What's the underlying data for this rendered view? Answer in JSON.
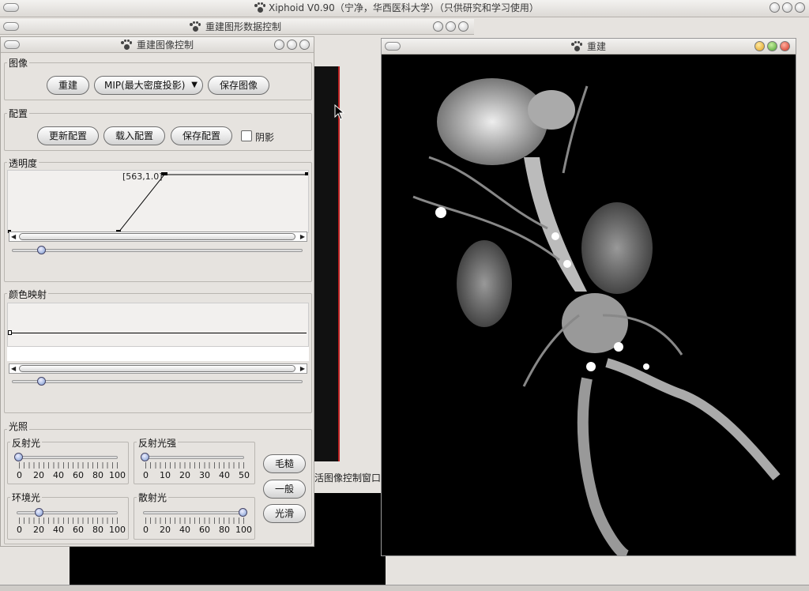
{
  "app": {
    "title": "Xiphoid V0.90（宁净，华西医科大学）（只供研究和学习使用）"
  },
  "back_window": {
    "title": "重建图形数据控制",
    "status_text": "活图像控制窗口"
  },
  "control_window": {
    "title": "重建图像控制",
    "image_group": {
      "label": "图像",
      "rebuild": "重建",
      "mode": "MIP(最大密度投影)",
      "save_image": "保存图像"
    },
    "config_group": {
      "label": "配置",
      "update": "更新配置",
      "load": "载入配置",
      "save": "保存配置",
      "shadow_label": "阴影",
      "shadow_checked": false
    },
    "opacity_group": {
      "label": "透明度",
      "point_label": "[563,1.0]",
      "slider_value": 0.2
    },
    "color_group": {
      "label": "颜色映射",
      "slider_value": 0.2
    },
    "lighting_group": {
      "label": "光照",
      "reflect": {
        "label": "反射光",
        "ticks": [
          "0",
          "20",
          "40",
          "60",
          "80",
          "100"
        ],
        "value": 0
      },
      "reflect_strength": {
        "label": "反射光强",
        "ticks": [
          "0",
          "10",
          "20",
          "30",
          "40",
          "50"
        ],
        "value": 0
      },
      "ambient": {
        "label": "环境光",
        "ticks": [
          "0",
          "20",
          "40",
          "60",
          "80",
          "100"
        ],
        "value": 20
      },
      "diffuse": {
        "label": "散射光",
        "ticks": [
          "0",
          "20",
          "40",
          "60",
          "80",
          "100"
        ],
        "value": 100
      },
      "rough": "毛糙",
      "normal": "一般",
      "smooth": "光滑"
    }
  },
  "render_window": {
    "title": "重建"
  },
  "colors": {
    "render_bg": "#000000",
    "window_bg": "#e6e3df"
  }
}
